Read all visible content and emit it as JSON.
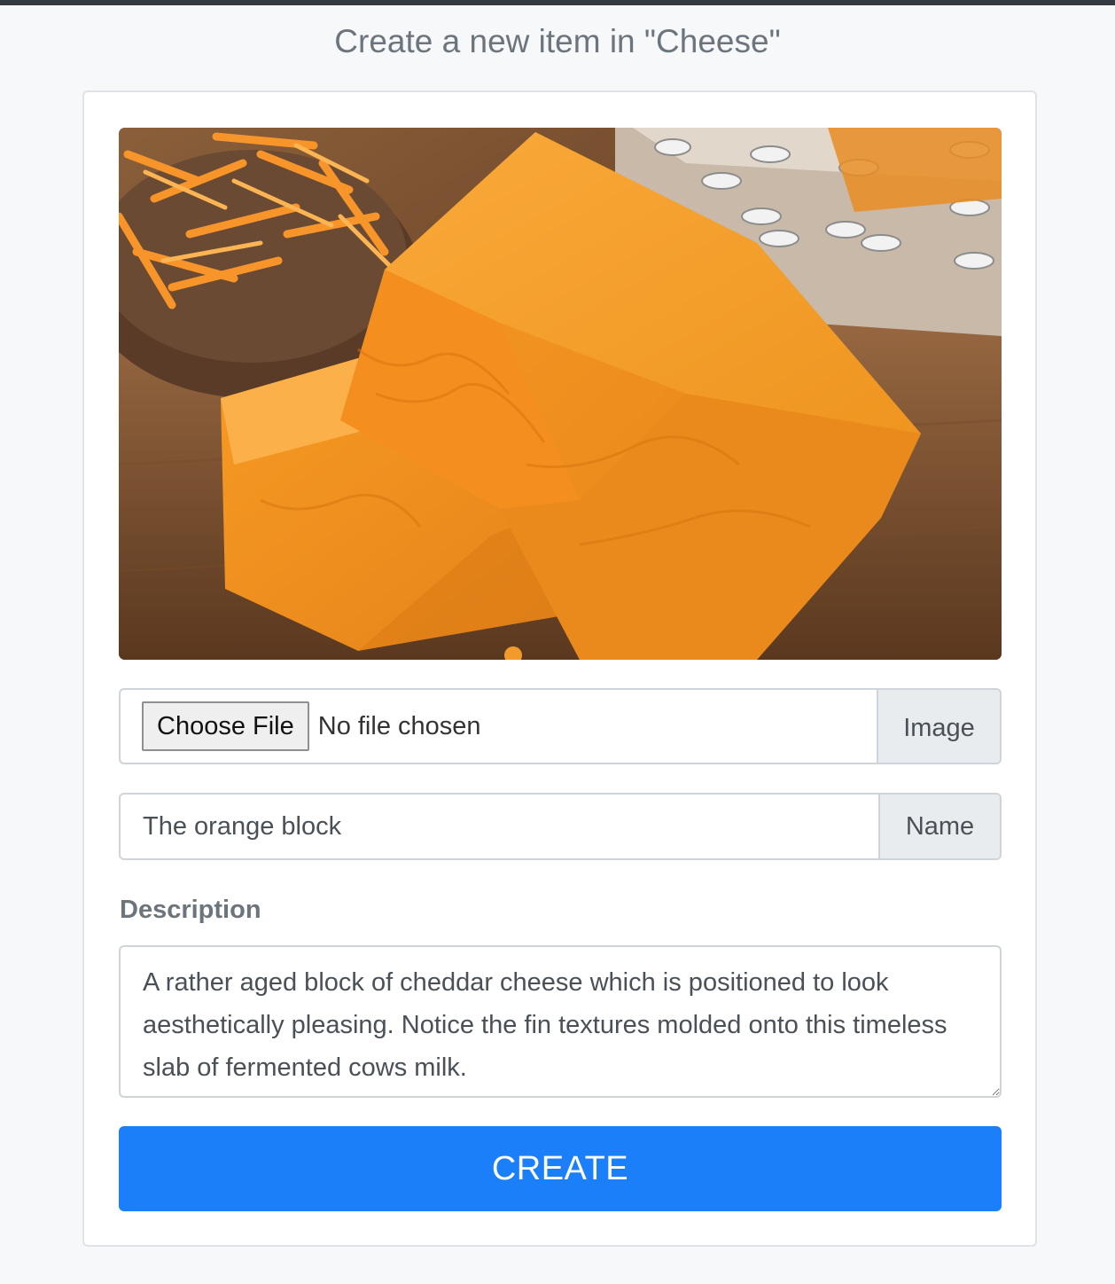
{
  "page": {
    "title": "Create a new item in \"Cheese\""
  },
  "form": {
    "image_preview_alt": "Block of cheddar cheese on a wooden board",
    "file": {
      "button_label": "Choose File",
      "status_text": "No file chosen",
      "addon_label": "Image"
    },
    "name": {
      "value": "The orange block",
      "addon_label": "Name"
    },
    "description": {
      "label": "Description",
      "value": "A rather aged block of cheddar cheese which is positioned to look aesthetically pleasing. Notice the fin textures molded onto this timeless slab of fermented cows milk."
    },
    "submit_label": "CREATE"
  },
  "colors": {
    "accent": "#1a7ff8",
    "top_bar": "#343a40",
    "background": "#f7f8fa"
  }
}
